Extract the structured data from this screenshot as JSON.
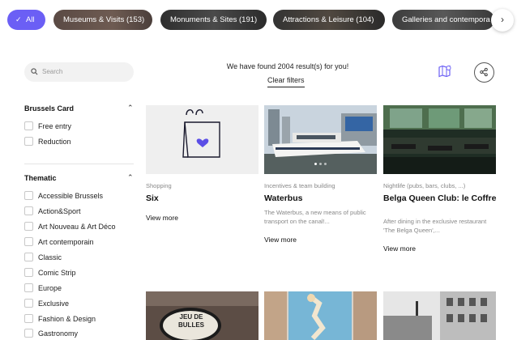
{
  "colors": {
    "accent": "#6b5ff5",
    "text": "#222222",
    "muted": "#888888"
  },
  "categories": [
    {
      "label": "All",
      "active": true,
      "icon": "check-icon"
    },
    {
      "label": "Museums & Visits (153)",
      "active": false
    },
    {
      "label": "Monuments & Sites (191)",
      "active": false
    },
    {
      "label": "Attractions & Leisure (104)",
      "active": false
    },
    {
      "label": "Galleries and contempora",
      "active": false
    }
  ],
  "search": {
    "placeholder": "Search",
    "value": ""
  },
  "results": {
    "text": "We have found 2004 result(s) for you!",
    "clear_label": "Clear filters"
  },
  "filters": [
    {
      "title": "Brussels Card",
      "expanded": true,
      "options": [
        "Free entry",
        "Reduction"
      ]
    },
    {
      "title": "Thematic",
      "expanded": true,
      "options": [
        "Accessible Brussels",
        "Action&Sport",
        "Art Nouveau & Art Déco",
        "Art contemporain",
        "Classic",
        "Comic Strip",
        "Europe",
        "Exclusive",
        "Fashion & Design",
        "Gastronomy"
      ]
    }
  ],
  "cards": [
    {
      "category": "Shopping",
      "title": "Six",
      "description": "",
      "more_label": "View more",
      "image": "shopping-bag-heart-icon"
    },
    {
      "category": "Incentives & team building",
      "title": "Waterbus",
      "description": "The Waterbus, a new means of public transport on the canal!...",
      "more_label": "View more",
      "image": "waterbus-photo"
    },
    {
      "category": "Nightlife (pubs, bars, clubs, ...)",
      "title": "Belga Queen Club: le Coffre",
      "description": "After dining in the exclusive restaurant 'The Belga Queen',...",
      "more_label": "View more",
      "image": "club-interior-photo"
    }
  ],
  "bottom_cards": [
    {
      "image": "jeu-de-boules-sign-photo",
      "sign_text": "JEU DE BULLES"
    },
    {
      "image": "street-mural-photo"
    },
    {
      "image": "building-bw-photo"
    }
  ]
}
